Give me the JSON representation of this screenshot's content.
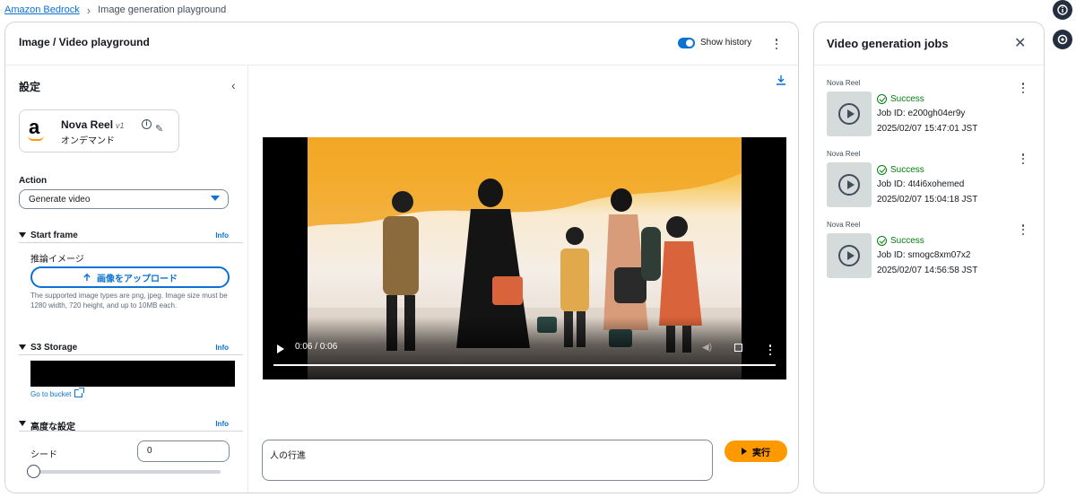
{
  "breadcrumb": {
    "root": "Amazon Bedrock",
    "current": "Image generation playground"
  },
  "playground": {
    "title": "Image / Video playground",
    "show_history": "Show history"
  },
  "settings": {
    "title": "設定",
    "model": {
      "name": "Nova Reel",
      "version": "v1",
      "mode": "オンデマンド",
      "logo": "a"
    },
    "action_label": "Action",
    "action_value": "Generate video",
    "start_frame": {
      "title": "Start frame",
      "info": "Info",
      "sub_label": "推論イメージ",
      "upload_label": "画像をアップロード",
      "help": "The supported image types are png, jpeg. Image size must be 1280 width, 720 height, and up to 10MB each."
    },
    "s3": {
      "title": "S3 Storage",
      "info": "Info",
      "goto": "Go to bucket"
    },
    "advanced": {
      "title": "高度な設定",
      "info": "Info",
      "seed_label": "シード",
      "seed_value": "0",
      "seed_slider_fraction": 0
    }
  },
  "video": {
    "time": "0:06 / 0:06",
    "progress_fraction": 1.0
  },
  "prompt": {
    "value": "人の行進",
    "run_label": "実行"
  },
  "jobs": {
    "title": "Video generation jobs",
    "items": [
      {
        "model": "Nova Reel",
        "status": "Success",
        "job_id": "Job ID: e200gh04er9y",
        "time": "2025/02/07 15:47:01 JST"
      },
      {
        "model": "Nova Reel",
        "status": "Success",
        "job_id": "Job ID: 4t4i6xohemed",
        "time": "2025/02/07 15:04:18 JST"
      },
      {
        "model": "Nova Reel",
        "status": "Success",
        "job_id": "Job ID: smogc8xm07x2",
        "time": "2025/02/07 14:56:58 JST"
      }
    ]
  },
  "colors": {
    "accent": "#0972d3",
    "run_button": "#ff9900",
    "success": "#037f0c"
  },
  "icons": [
    "info-icon",
    "feedback-icon",
    "chevron-left-icon",
    "edit-icon",
    "upload-icon",
    "external-link-icon",
    "download-icon",
    "play-icon",
    "fullscreen-icon",
    "volume-icon",
    "close-icon",
    "check-circle-icon",
    "more-vertical-icon"
  ]
}
